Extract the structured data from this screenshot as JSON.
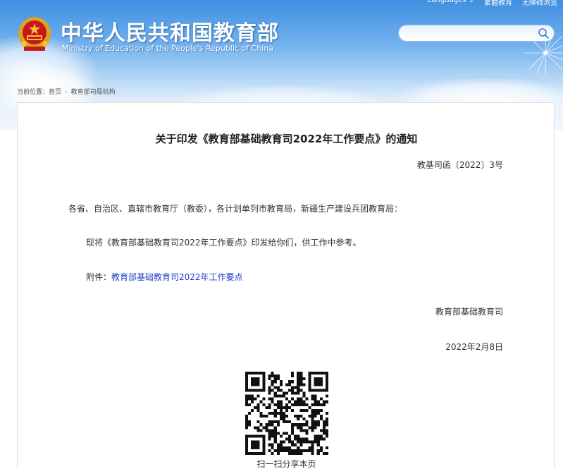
{
  "header": {
    "top_links": [
      "Languages ⌄",
      "繁體教育",
      "无障碍浏览"
    ],
    "site_title": "中华人民共和国教育部",
    "site_subtitle": "Ministry of Education of the People's Republic of China",
    "search_placeholder": "",
    "colors": {
      "sky_top": "#3f8fe0",
      "sky_bottom": "#f4f8fc"
    }
  },
  "breadcrumb": {
    "label": "当前位置：",
    "items": [
      "首页",
      "教育部司局机构"
    ]
  },
  "article": {
    "title": "关于印发《教育部基础教育司2022年工作要点》的通知",
    "doc_number": "教基司函〔2022〕3号",
    "salutation": "各省、自治区、直辖市教育厅（教委），各计划单列市教育局，新疆生产建设兵团教育局：",
    "body": "现将《教育部基础教育司2022年工作要点》印发给你们，供工作中参考。",
    "attachment_label": "附件：",
    "attachment_link": "教育部基础教育司2022年工作要点",
    "signature": "教育部基础教育司",
    "date": "2022年2月8日",
    "qr_caption": "扫一扫分享本页",
    "link_color": "#1a3fc9"
  }
}
